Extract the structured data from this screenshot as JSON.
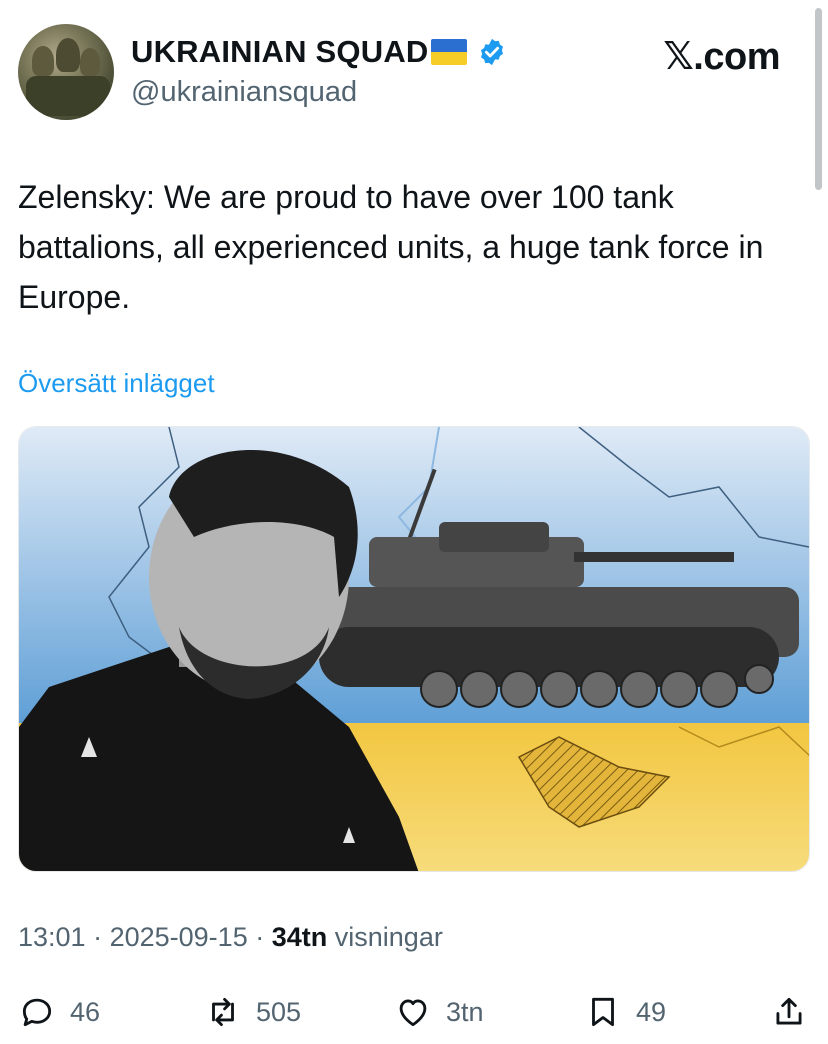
{
  "author": {
    "display_name": "UKRAINIAN SQUAD",
    "handle": "@ukrainiansquad",
    "verified": true
  },
  "watermark": "𝕏.com",
  "tweet": {
    "text": "Zelensky: We are proud to have over 100 tank battalions, all experienced units, a huge tank force in Europe.",
    "translate_link": "Översätt inlägget"
  },
  "meta": {
    "time": "13:01",
    "date": "2025-09-15",
    "views_count": "34tn",
    "views_label": "visningar"
  },
  "actions": {
    "replies": "46",
    "reposts": "505",
    "likes": "3tn",
    "bookmarks": "49"
  },
  "colors": {
    "link": "#1d9bf0",
    "muted": "#536471",
    "flag_blue": "#2b6fd1",
    "flag_yellow": "#f5cd26"
  }
}
